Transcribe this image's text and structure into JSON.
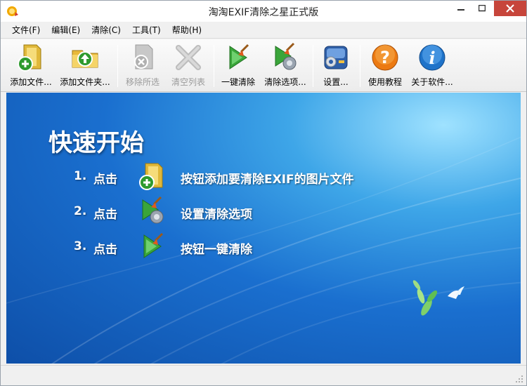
{
  "window": {
    "title": "淘淘EXIF清除之星正式版"
  },
  "menu": [
    {
      "label": "文件(F)"
    },
    {
      "label": "编辑(E)"
    },
    {
      "label": "清除(C)"
    },
    {
      "label": "工具(T)"
    },
    {
      "label": "帮助(H)"
    }
  ],
  "toolbar": {
    "add_file": "添加文件...",
    "add_folder": "添加文件夹...",
    "remove_selected": "移除所选",
    "clear_list": "清空列表",
    "one_click_clean": "一键清除",
    "clean_options": "清除选项...",
    "settings": "设置...",
    "tutorial": "使用教程",
    "about": "关于软件..."
  },
  "quickstart": {
    "title": "快速开始",
    "steps": [
      {
        "num": "1.",
        "click": "点击",
        "icon": "add-file-icon",
        "desc": "按钮添加要清除EXIF的图片文件"
      },
      {
        "num": "2.",
        "click": "点击",
        "icon": "clean-options-icon",
        "desc": "设置清除选项"
      },
      {
        "num": "3.",
        "click": "点击",
        "icon": "one-click-clean-icon",
        "desc": "按钮一键清除"
      }
    ]
  },
  "colors": {
    "close_button": "#c7453b",
    "main_background": "#1a6fcf",
    "accent_green": "#3aa53a"
  }
}
